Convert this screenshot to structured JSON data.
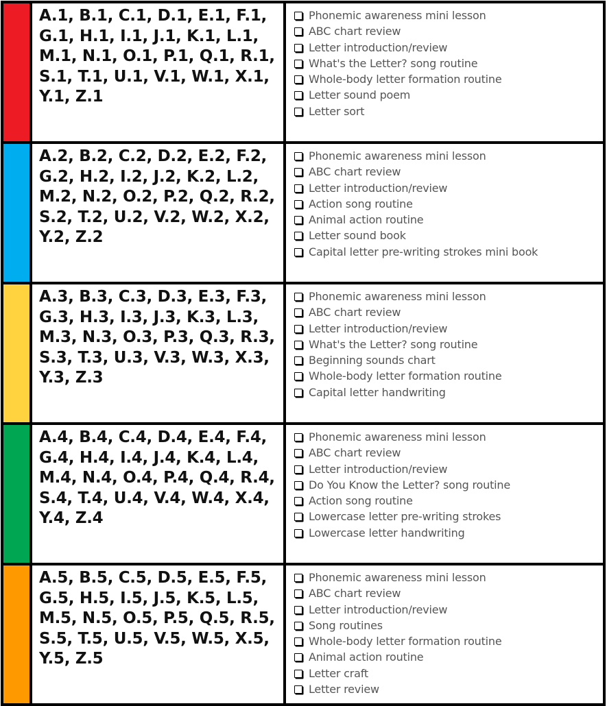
{
  "rows": [
    {
      "color": "#ED1C24",
      "letters": "A.1, B.1, C.1, D.1, E.1, F.1, G.1, H.1, I.1, J.1, K.1, L.1, M.1, N.1, O.1, P.1, Q.1, R.1, S.1, T.1, U.1, V.1, W.1, X.1, Y.1, Z.1",
      "items": [
        "Phonemic awareness mini lesson",
        "ABC chart review",
        "Letter introduction/review",
        "What's the Letter? song routine",
        "Whole-body letter formation routine",
        "Letter sound poem",
        "Letter sort"
      ]
    },
    {
      "color": "#00AEEF",
      "letters": "A.2, B.2, C.2, D.2, E.2, F.2, G.2, H.2, I.2, J.2, K.2, L.2, M.2, N.2, O.2, P.2, Q.2, R.2, S.2, T.2, U.2, V.2, W.2, X.2, Y.2, Z.2",
      "items": [
        "Phonemic awareness mini lesson",
        "ABC chart review",
        "Letter introduction/review",
        "Action song routine",
        "Animal action routine",
        "Letter sound book",
        "Capital letter pre-writing strokes mini book"
      ]
    },
    {
      "color": "#FFD23F",
      "letters": "A.3, B.3, C.3, D.3, E.3, F.3, G.3, H.3, I.3, J.3, K.3, L.3, M.3, N.3, O.3, P.3, Q.3, R.3, S.3, T.3, U.3, V.3, W.3, X.3, Y.3, Z.3",
      "items": [
        "Phonemic awareness mini lesson",
        "ABC chart review",
        "Letter introduction/review",
        "What's the Letter? song routine",
        "Beginning sounds chart",
        "Whole-body letter formation routine",
        "Capital letter handwriting"
      ]
    },
    {
      "color": "#00A651",
      "letters": "A.4, B.4, C.4, D.4, E.4, F.4, G.4, H.4, I.4, J.4, K.4, L.4, M.4, N.4, O.4, P.4, Q.4, R.4, S.4, T.4, U.4, V.4, W.4, X.4, Y.4, Z.4",
      "items": [
        "Phonemic awareness mini lesson",
        "ABC chart review",
        "Letter introduction/review",
        "Do You Know the Letter? song routine",
        "Action song routine",
        "Lowercase letter pre-writing strokes",
        "Lowercase letter handwriting"
      ]
    },
    {
      "color": "#FF9900",
      "letters": "A.5, B.5, C.5, D.5, E.5, F.5, G.5, H.5, I.5, J.5, K.5, L.5, M.5, N.5, O.5, P.5, Q.5, R.5, S.5, T.5, U.5, V.5, W.5, X.5, Y.5, Z.5",
      "items": [
        "Phonemic awareness mini lesson",
        "ABC chart review",
        "Letter introduction/review",
        "Song routines",
        "Whole-body letter formation routine",
        "Animal action routine",
        "Letter craft",
        "Letter review"
      ]
    }
  ]
}
